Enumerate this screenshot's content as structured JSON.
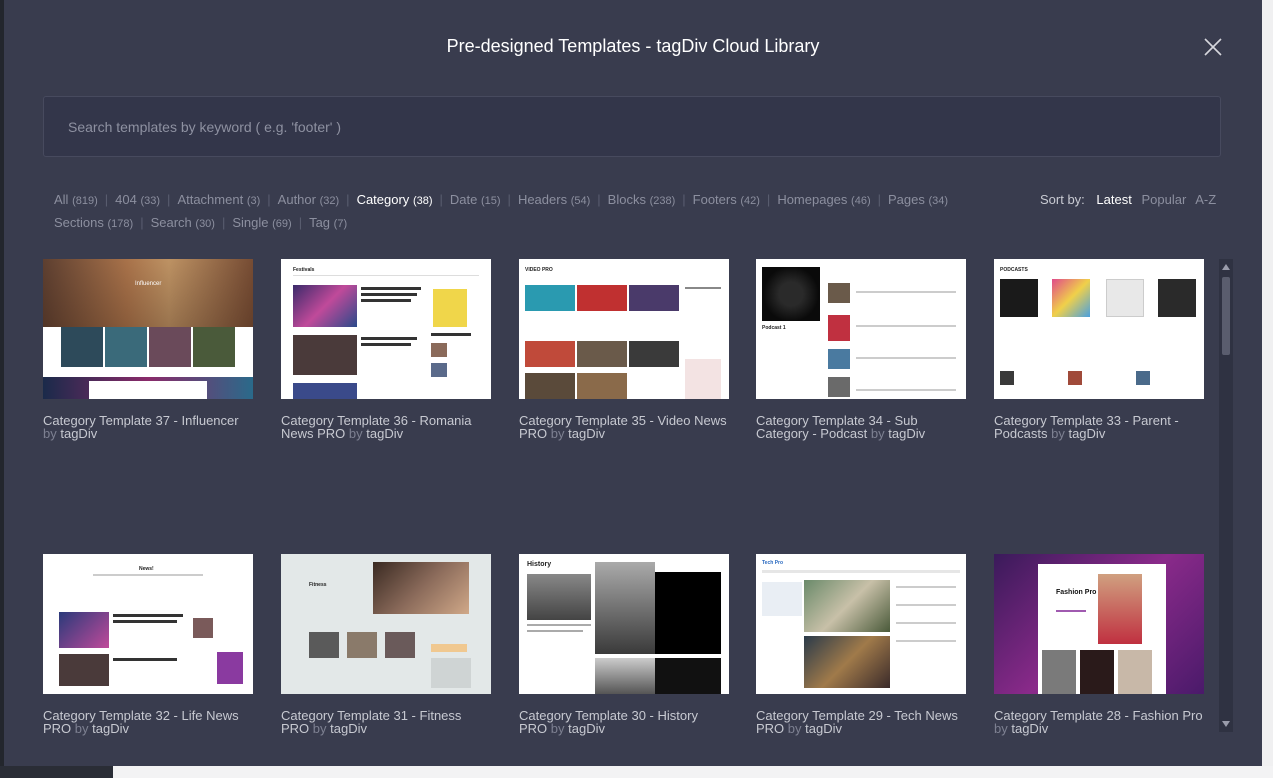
{
  "modal": {
    "title": "Pre-designed Templates - tagDiv Cloud Library"
  },
  "search": {
    "placeholder": "Search templates by keyword ( e.g. 'footer' )"
  },
  "filters": [
    {
      "label": "All",
      "count": "(819)"
    },
    {
      "label": "404",
      "count": "(33)"
    },
    {
      "label": "Attachment",
      "count": "(3)"
    },
    {
      "label": "Author",
      "count": "(32)"
    },
    {
      "label": "Category",
      "count": "(38)"
    },
    {
      "label": "Date",
      "count": "(15)"
    },
    {
      "label": "Headers",
      "count": "(54)"
    },
    {
      "label": "Blocks",
      "count": "(238)"
    },
    {
      "label": "Footers",
      "count": "(42)"
    },
    {
      "label": "Homepages",
      "count": "(46)"
    },
    {
      "label": "Pages",
      "count": "(34)"
    },
    {
      "label": "Sections",
      "count": "(178)"
    },
    {
      "label": "Search",
      "count": "(30)"
    },
    {
      "label": "Single",
      "count": "(69)"
    },
    {
      "label": "Tag",
      "count": "(7)"
    }
  ],
  "sort": {
    "label": "Sort by:",
    "options": [
      "Latest",
      "Popular",
      "A-Z"
    ]
  },
  "cards": [
    {
      "title": "Category Template 37 - Influencer",
      "by": "by",
      "author": "tagDiv",
      "thumb_text": "Influencer"
    },
    {
      "title": "Category Template 36 - Romania News PRO",
      "by": "by",
      "author": "tagDiv",
      "thumb_text": "Festivals"
    },
    {
      "title": "Category Template 35 - Video News PRO",
      "by": "by",
      "author": "tagDiv",
      "thumb_text": "VIDEO PRO"
    },
    {
      "title": "Category Template 34 - Sub Category - Podcast",
      "by": "by",
      "author": "tagDiv",
      "thumb_text": "Podcast 1"
    },
    {
      "title": "Category Template 33 - Parent - Podcasts",
      "by": "by",
      "author": "tagDiv",
      "thumb_text": "PODCASTS"
    },
    {
      "title": "Category Template 32 - Life News PRO",
      "by": "by",
      "author": "tagDiv",
      "thumb_text": "News!"
    },
    {
      "title": "Category Template 31 - Fitness PRO",
      "by": "by",
      "author": "tagDiv",
      "thumb_text": "Fitness"
    },
    {
      "title": "Category Template 30 - History PRO",
      "by": "by",
      "author": "tagDiv",
      "thumb_text": "History"
    },
    {
      "title": "Category Template 29 - Tech News PRO",
      "by": "by",
      "author": "tagDiv",
      "thumb_text": "Tech Pro"
    },
    {
      "title": "Category Template 28 - Fashion Pro",
      "by": "by",
      "author": "tagDiv",
      "thumb_text": "Fashion Pro"
    }
  ],
  "colors": {
    "modal_bg": "#393c4e",
    "search_bg": "#33364a",
    "active_text": "#ffffff",
    "muted_text": "#8c8f9f"
  }
}
